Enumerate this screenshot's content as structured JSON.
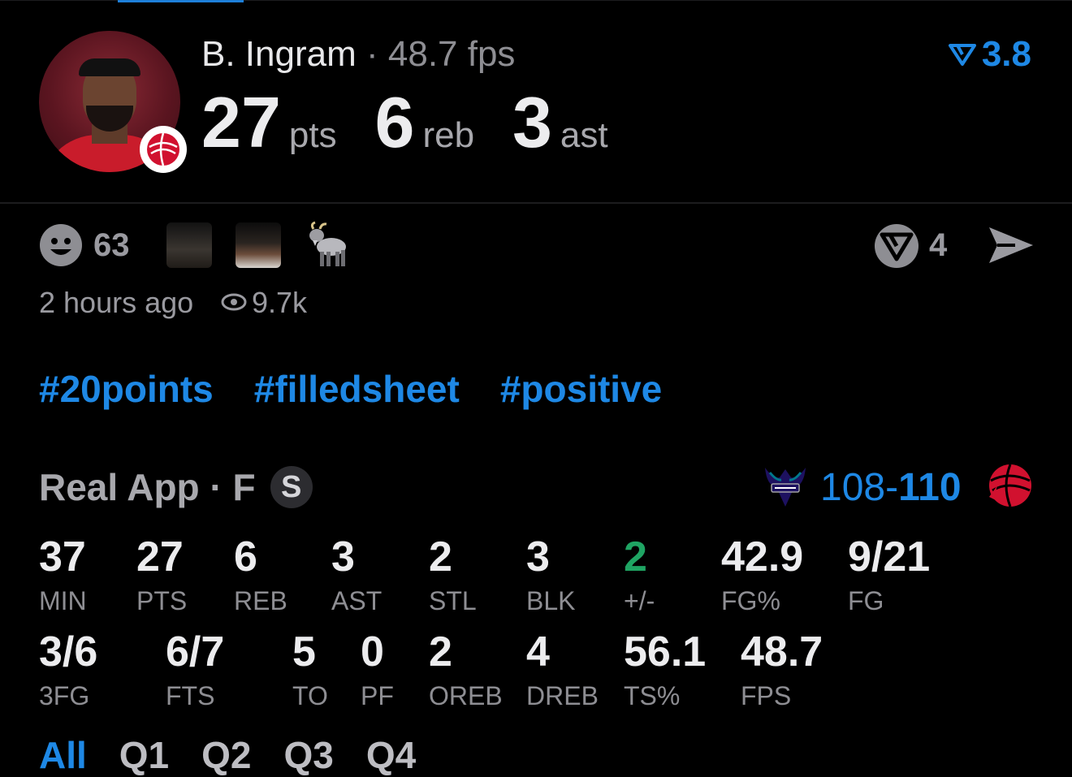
{
  "header": {
    "player_name": "B. Ingram",
    "separator": "·",
    "fps": "48.7 fps",
    "rating": "3.8",
    "stats": [
      {
        "value": "27",
        "label": "pts"
      },
      {
        "value": "6",
        "label": "reb"
      },
      {
        "value": "3",
        "label": "ast"
      }
    ]
  },
  "social": {
    "reaction_count": "63",
    "share_count": "4",
    "time_ago": "2 hours ago",
    "views": "9.7k"
  },
  "hashtags": [
    "#20points",
    "#filledsheet",
    "#positive"
  ],
  "game": {
    "source": "Real App · F",
    "badge": "S",
    "score_left": "108-",
    "score_right": "110"
  },
  "box_row1": [
    {
      "value": "37",
      "label": "MIN"
    },
    {
      "value": "27",
      "label": "PTS"
    },
    {
      "value": "6",
      "label": "REB"
    },
    {
      "value": "3",
      "label": "AST"
    },
    {
      "value": "2",
      "label": "STL"
    },
    {
      "value": "3",
      "label": "BLK"
    },
    {
      "value": "2",
      "label": "+/-"
    },
    {
      "value": "42.9",
      "label": "FG%"
    },
    {
      "value": "9/21",
      "label": "FG"
    }
  ],
  "box_row2": [
    {
      "value": "3/6",
      "label": "3FG"
    },
    {
      "value": "6/7",
      "label": "FTS"
    },
    {
      "value": "5",
      "label": "TO"
    },
    {
      "value": "0",
      "label": "PF"
    },
    {
      "value": "2",
      "label": "OREB"
    },
    {
      "value": "4",
      "label": "DREB"
    },
    {
      "value": "56.1",
      "label": "TS%"
    },
    {
      "value": "48.7",
      "label": "FPS"
    }
  ],
  "tabs": [
    "All",
    "Q1",
    "Q2",
    "Q3",
    "Q4"
  ],
  "colors": {
    "accent": "#1e88e5",
    "positive": "#1fa463",
    "muted": "#8e8e93"
  }
}
